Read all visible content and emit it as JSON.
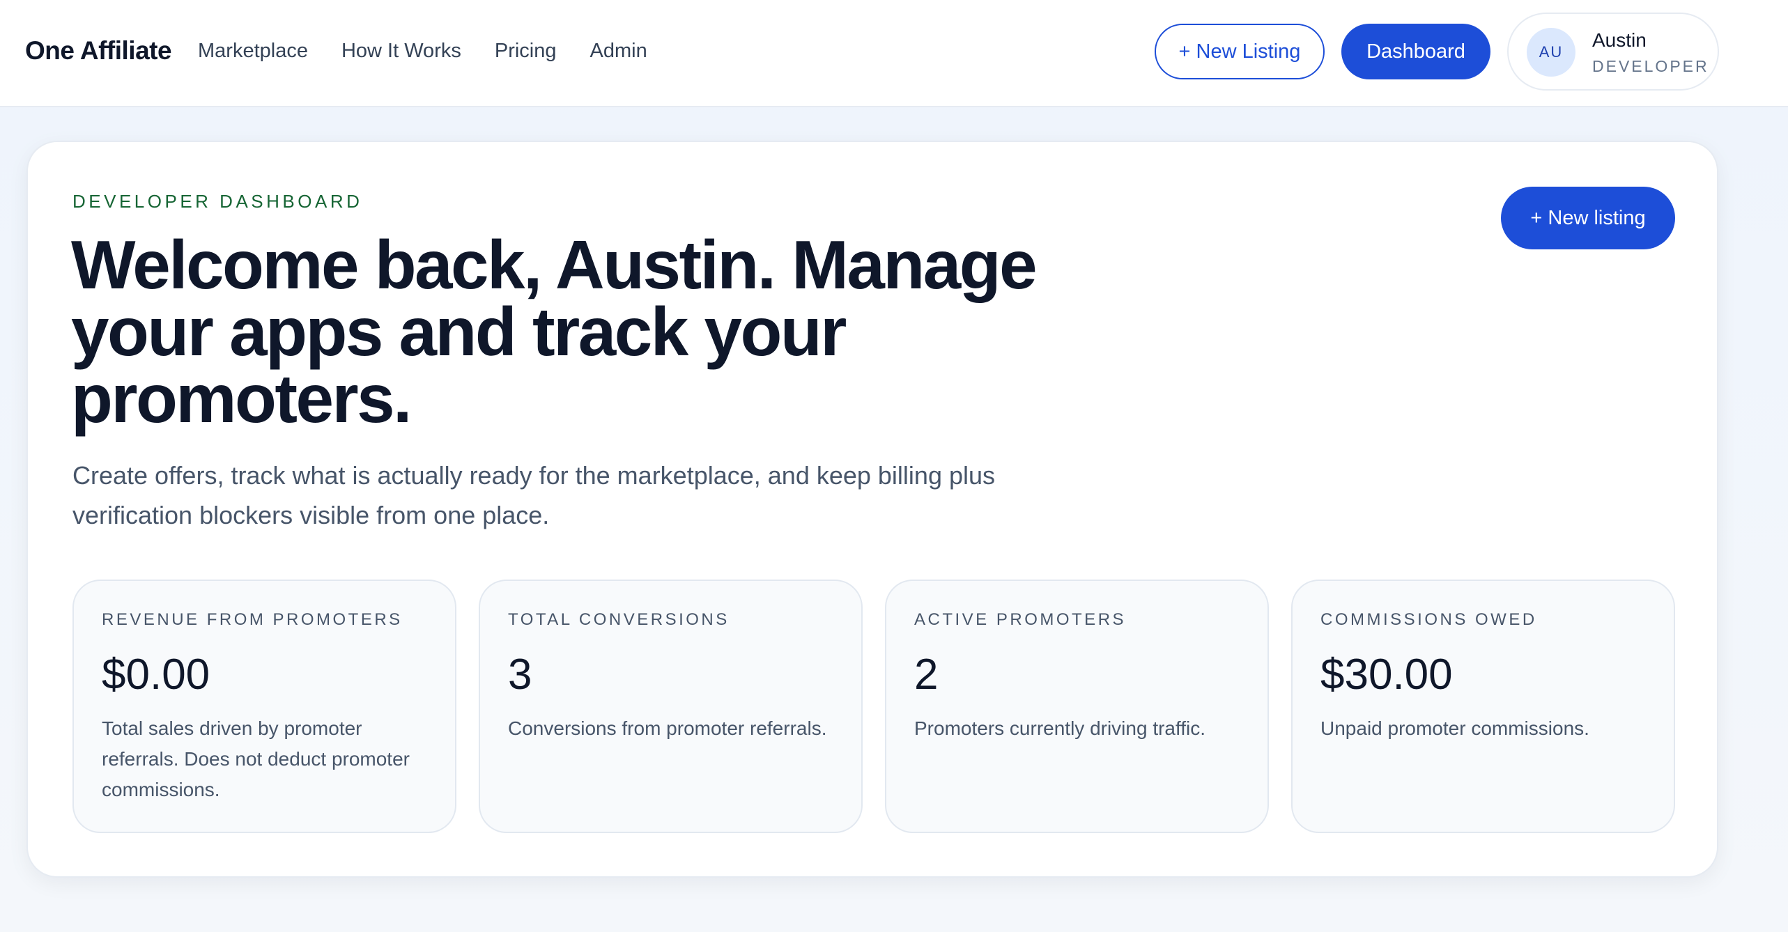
{
  "header": {
    "brand": "One Affiliate",
    "nav": [
      "Marketplace",
      "How It Works",
      "Pricing",
      "Admin"
    ],
    "new_listing_label": "+ New Listing",
    "dashboard_label": "Dashboard",
    "user": {
      "initials": "AU",
      "name": "Austin",
      "role": "DEVELOPER"
    }
  },
  "main": {
    "eyebrow": "DEVELOPER DASHBOARD",
    "title": "Welcome back, Austin. Manage your apps and track your promoters.",
    "subtitle": "Create offers, track what is actually ready for the marketplace, and keep billing plus verification blockers visible from one place.",
    "new_listing_label": "+ New listing",
    "stats": [
      {
        "label": "REVENUE FROM PROMOTERS",
        "value": "$0.00",
        "description": "Total sales driven by promoter referrals. Does not deduct promoter commissions."
      },
      {
        "label": "TOTAL CONVERSIONS",
        "value": "3",
        "description": "Conversions from promoter referrals."
      },
      {
        "label": "ACTIVE PROMOTERS",
        "value": "2",
        "description": "Promoters currently driving traffic."
      },
      {
        "label": "COMMISSIONS OWED",
        "value": "$30.00",
        "description": "Unpaid promoter commissions."
      }
    ]
  },
  "colors": {
    "accent": "#1d4ed8",
    "eyebrow": "#166534",
    "text": "#0f172a",
    "muted": "#475569"
  }
}
